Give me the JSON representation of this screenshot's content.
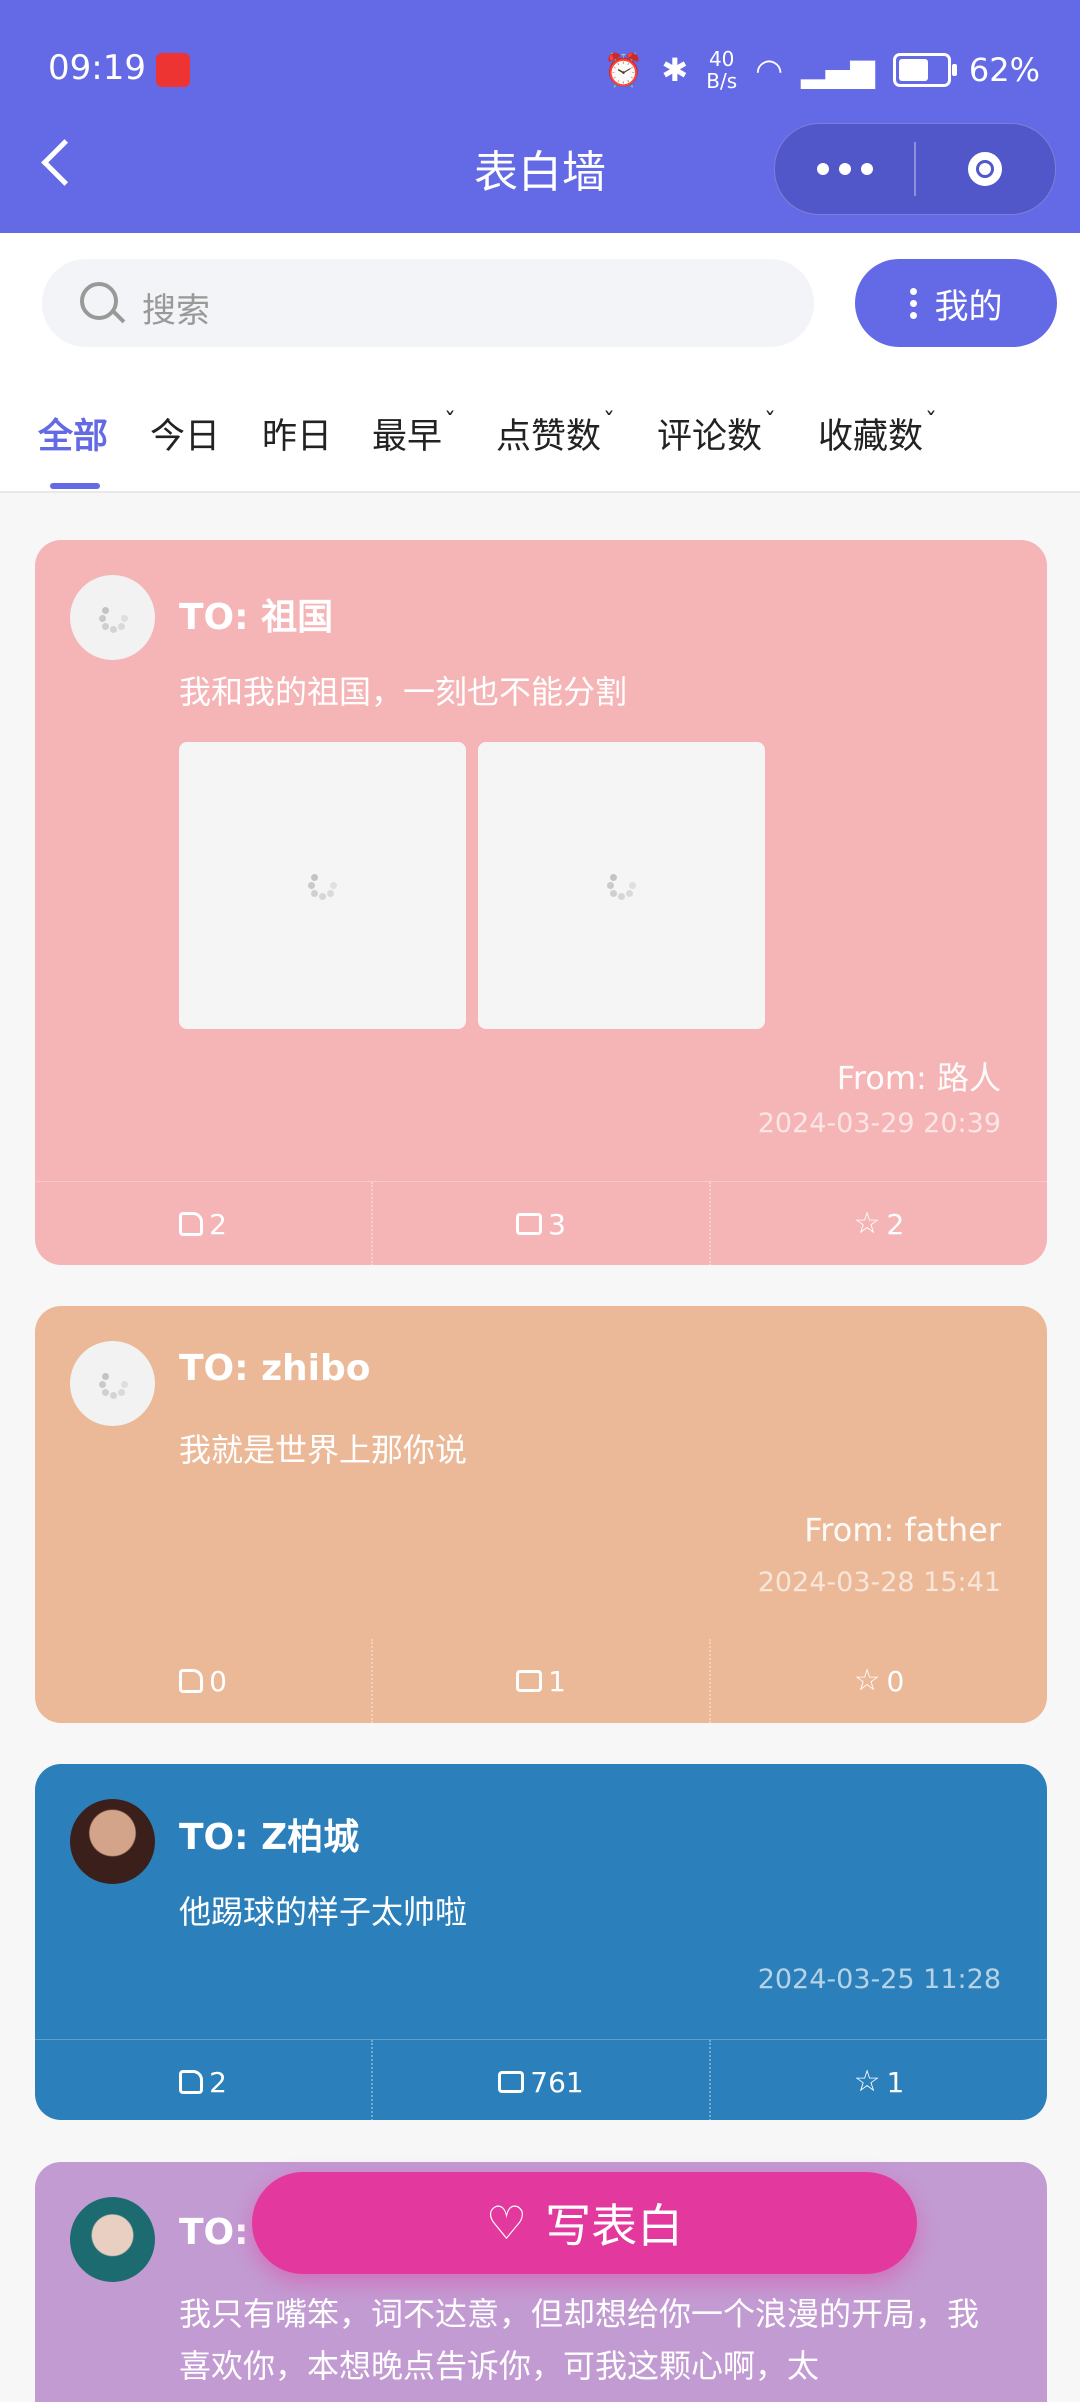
{
  "status_bar": {
    "time": "09:19",
    "net_speed_value": "40",
    "net_speed_unit": "B/s",
    "battery": "62%",
    "battery_level": 0.62
  },
  "header": {
    "title": "表白墙"
  },
  "search": {
    "placeholder": "搜索",
    "mine_label": "我的"
  },
  "tabs": [
    {
      "label": "全部",
      "active": true
    },
    {
      "label": "今日"
    },
    {
      "label": "昨日"
    },
    {
      "label": "最早",
      "caret": "ˇ"
    },
    {
      "label": "点赞数",
      "caret": "ˇ"
    },
    {
      "label": "评论数",
      "caret": "ˇ"
    },
    {
      "label": "收藏数",
      "caret": "ˇ"
    }
  ],
  "cards": [
    {
      "color": "#f5b5b7",
      "to": "TO: 祖国",
      "message": "我和我的祖国，一刻也不能分割",
      "from": "From: 路人",
      "time": "2024-03-29 20:39",
      "likes": "2",
      "comments": "3",
      "stars": "2"
    },
    {
      "color": "#ebb998",
      "to": "TO: zhibo",
      "message": "我就是世界上那你说",
      "from": "From: father",
      "time": "2024-03-28 15:41",
      "likes": "0",
      "comments": "1",
      "stars": "0"
    },
    {
      "color": "#2b7fba",
      "to": "TO: Z柏城",
      "message": "他踢球的样子太帅啦",
      "time": "2024-03-25 11:28",
      "likes": "2",
      "comments": "761",
      "stars": "1"
    },
    {
      "color": "#c39bd3",
      "to": "TO:",
      "message": "我只有嘴笨，词不达意，但却想给你一个浪漫的开局，我喜欢你，本想晚点告诉你，可我这颗心啊，太"
    }
  ],
  "fab": {
    "label": "写表白"
  }
}
